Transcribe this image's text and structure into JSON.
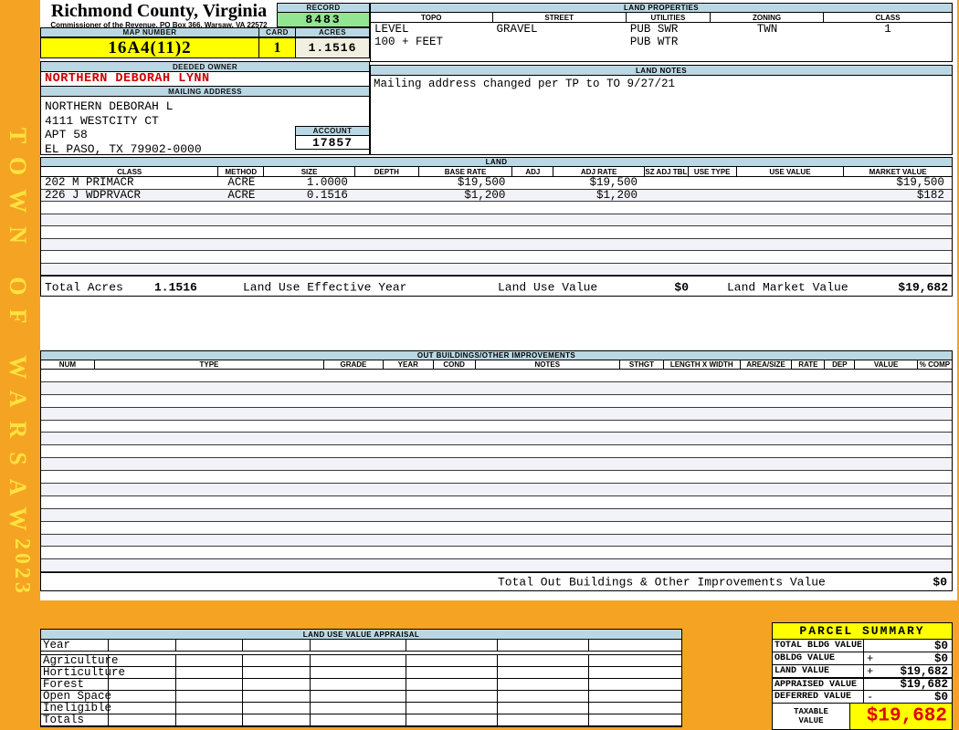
{
  "sidebar": {
    "banner": "TOWN OF WARSAW",
    "year": "2023"
  },
  "header": {
    "county": "Richmond County, Virginia",
    "commissioner": "Commissioner of the Revenue, PO Box 366, Warsaw, VA 22572",
    "record_label": "RECORD",
    "record_value": "8483",
    "map_number_label": "MAP NUMBER",
    "map_number": "16A4(11)2",
    "card_label": "CARD",
    "card": "1",
    "acres_label": "ACRES",
    "acres": "1.1516",
    "deeded_owner_label": "DEEDED OWNER",
    "deeded_owner": "NORTHERN DEBORAH LYNN",
    "mailing_address_label": "MAILING ADDRESS",
    "address_lines": [
      "NORTHERN DEBORAH L",
      "4111 WESTCITY CT",
      "APT 58",
      "EL PASO, TX 79902-0000"
    ],
    "account_label": "ACCOUNT",
    "account": "17857"
  },
  "land_properties": {
    "title": "LAND PROPERTIES",
    "columns": [
      "TOPO",
      "STREET",
      "UTILITIES",
      "ZONING",
      "CLASS"
    ],
    "rows": [
      [
        "LEVEL",
        "GRAVEL",
        "PUB SWR",
        "TWN",
        "1"
      ],
      [
        "100 + FEET",
        "",
        "PUB WTR",
        "",
        ""
      ]
    ]
  },
  "land_notes": {
    "title": "LAND NOTES",
    "text": "Mailing address changed per TP to TO 9/27/21"
  },
  "land": {
    "title": "LAND",
    "columns": [
      "CLASS",
      "METHOD",
      "SIZE",
      "DEPTH",
      "BASE RATE",
      "ADJ",
      "ADJ RATE",
      "SZ ADJ TBL",
      "USE TYPE",
      "USE VALUE",
      "MARKET VALUE"
    ],
    "rows": [
      [
        "202 M PRIMACR",
        "ACRE",
        "1.0000",
        "",
        "$19,500",
        "",
        "$19,500",
        "",
        "",
        "",
        "$19,500"
      ],
      [
        "226 J WDPRVACR",
        "ACRE",
        "0.1516",
        "",
        "$1,200",
        "",
        "$1,200",
        "",
        "",
        "",
        "$182"
      ]
    ],
    "empty_row_count": 6,
    "totals": {
      "total_acres_label": "Total Acres",
      "total_acres": "1.1516",
      "effective_year_label": "Land Use Effective Year",
      "use_value_label": "Land Use Value",
      "use_value": "$0",
      "market_value_label": "Land Market Value",
      "market_value": "$19,682"
    }
  },
  "out_buildings": {
    "title": "OUT BUILDINGS/OTHER IMPROVEMENTS",
    "columns": [
      "NUM",
      "TYPE",
      "GRADE",
      "YEAR",
      "COND",
      "NOTES",
      "STHGT",
      "LENGTH X WIDTH",
      "AREA/SIZE",
      "RATE",
      "DEP",
      "VALUE",
      "% COMP"
    ],
    "empty_row_count": 16,
    "total_label": "Total Out Buildings & Other Improvements Value",
    "total_value": "$0"
  },
  "land_use_appraisal": {
    "title": "LAND USE VALUE APPRAISAL",
    "row_labels": [
      "Year",
      "Agriculture",
      "Horticulture",
      "Forest",
      "Open Space",
      "Ineligible",
      "Totals"
    ],
    "data_column_count": 7
  },
  "parcel_summary": {
    "title": "PARCEL SUMMARY",
    "rows": [
      {
        "label": "TOTAL BLDG VALUE",
        "sign": "",
        "value": "$0"
      },
      {
        "label": "OBLDG VALUE",
        "sign": "+",
        "value": "$0"
      },
      {
        "label": "LAND VALUE",
        "sign": "+",
        "value": "$19,682"
      },
      {
        "label": "APPRAISED VALUE",
        "sign": "",
        "value": "$19,682"
      },
      {
        "label": "DEFERRED VALUE",
        "sign": "-",
        "value": "$0"
      }
    ],
    "taxable_label": "TAXABLE VALUE",
    "taxable_value": "$19,682"
  },
  "colors": {
    "frame_orange": "#F5A323",
    "banner_yellow": "#FFE23E",
    "header_blue": "#BAD8E4",
    "record_green": "#92E692",
    "highlight_yellow": "#FFFF00",
    "cream": "#F1EFE0",
    "owner_red": "#CC0000",
    "taxable_red": "#E00000",
    "row_tint": "#F2F2F9"
  }
}
